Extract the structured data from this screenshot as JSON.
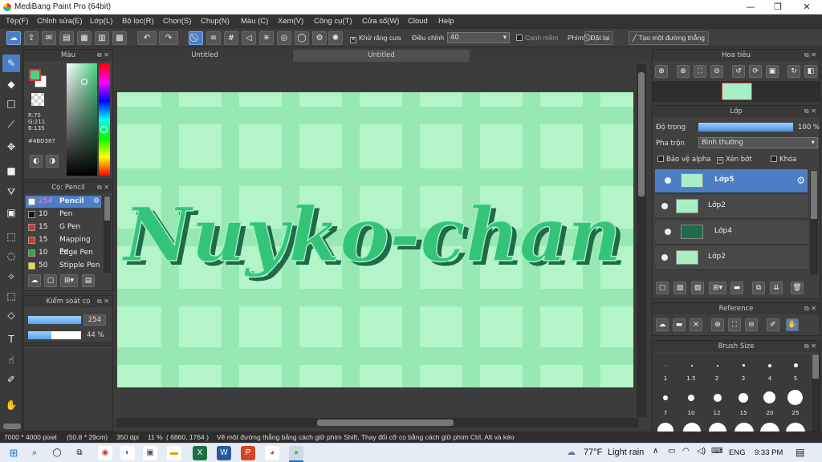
{
  "window": {
    "title": "MediBang Paint Pro (64bit)",
    "controls": [
      "—",
      "❐",
      "✕"
    ]
  },
  "menu": [
    "Tệp(F)",
    "Chỉnh sửa(E)",
    "Lớp(L)",
    "Bộ lọc(R)",
    "Chọn(S)",
    "Chụp(N)",
    "Màu (C)",
    "Xem(V)",
    "Công cụ(T)",
    "Cửa sổ(W)",
    "Cloud",
    "Help"
  ],
  "toolbar": {
    "antialias_label": "Khử răng cưa",
    "antialias_checked": "✕",
    "correction_label": "Điều chỉnh",
    "correction_value": "40",
    "edge_label": "Cạnh mềm",
    "key_label": "Phím",
    "reset_label": "Đặt lại",
    "create_line_label": "Tạo một đường thẳng"
  },
  "color_panel": {
    "title": "Màu",
    "r": "R:75",
    "g": "G:211",
    "b": "B:135",
    "hex": "#4BD387",
    "primary": "#4BD387",
    "secondary": "#ffffff"
  },
  "brush_panel": {
    "title": "Cọ: Pencil",
    "items": [
      {
        "size": "254",
        "name": "Pencil",
        "color": "#ffffff"
      },
      {
        "size": "10",
        "name": "Pen",
        "color": "#1a1a1a"
      },
      {
        "size": "15",
        "name": "G Pen",
        "color": "#e03030"
      },
      {
        "size": "15",
        "name": "Mapping Pe",
        "color": "#e03030"
      },
      {
        "size": "10",
        "name": "Edge Pen",
        "color": "#33aa33"
      },
      {
        "size": "50",
        "name": "Stipple Pen",
        "color": "#f0e020"
      }
    ]
  },
  "brush_control": {
    "title": "Kiểm soát cọ",
    "size": "254",
    "opacity": "44",
    "opacity_unit": "%",
    "size_fraction": 1.0,
    "opacity_fraction": 0.44
  },
  "tabs": [
    "Untitled",
    "Untitled"
  ],
  "canvas": {
    "lettering": "Nuyko-chan",
    "background": "#b3f5c8",
    "stripe_color": "#8ee4ad",
    "letter_color": "#33c47a"
  },
  "navigator": {
    "title": "Hoa tiêu"
  },
  "layer_panel": {
    "title": "Lớp",
    "opacity_label": "Độ trong",
    "opacity_value": "100 %",
    "opacity_fraction": 1.0,
    "blend_label": "Pha trộn",
    "blend_value": "Bình thường",
    "protect_alpha": "Bảo vệ alpha",
    "clipping": "Xén bớt",
    "clipping_checked": "✕",
    "lock": "Khóa",
    "layers": [
      {
        "name": "Lớp5",
        "selected": true
      },
      {
        "name": "Lớp2",
        "selected": false
      },
      {
        "name": "Lớp4",
        "selected": false
      },
      {
        "name": "Lớp2",
        "selected": false
      }
    ]
  },
  "reference_panel": {
    "title": "Reference"
  },
  "brush_size_panel": {
    "title": "Brush Size",
    "row1": [
      "1",
      "1.5",
      "2",
      "3",
      "4",
      "5"
    ],
    "row2": [
      "7",
      "10",
      "12",
      "15",
      "20",
      "25"
    ]
  },
  "status": {
    "size": "7000 * 4000 pixel",
    "cm": "(50.8 * 29cm)",
    "dpi": "350 dpi",
    "zoom": "11 %",
    "coords": "( 6860, 1764 )",
    "hint": "Vẽ một đường thẳng bằng cách giữ phím Shift, Thay đổi cỡ cọ bằng cách giữ phím Ctrl, Alt và kéo"
  },
  "taskbar": {
    "weather_temp": "77°F",
    "weather_desc": "Light rain",
    "lang": "ENG",
    "time": "9:33 PM"
  }
}
